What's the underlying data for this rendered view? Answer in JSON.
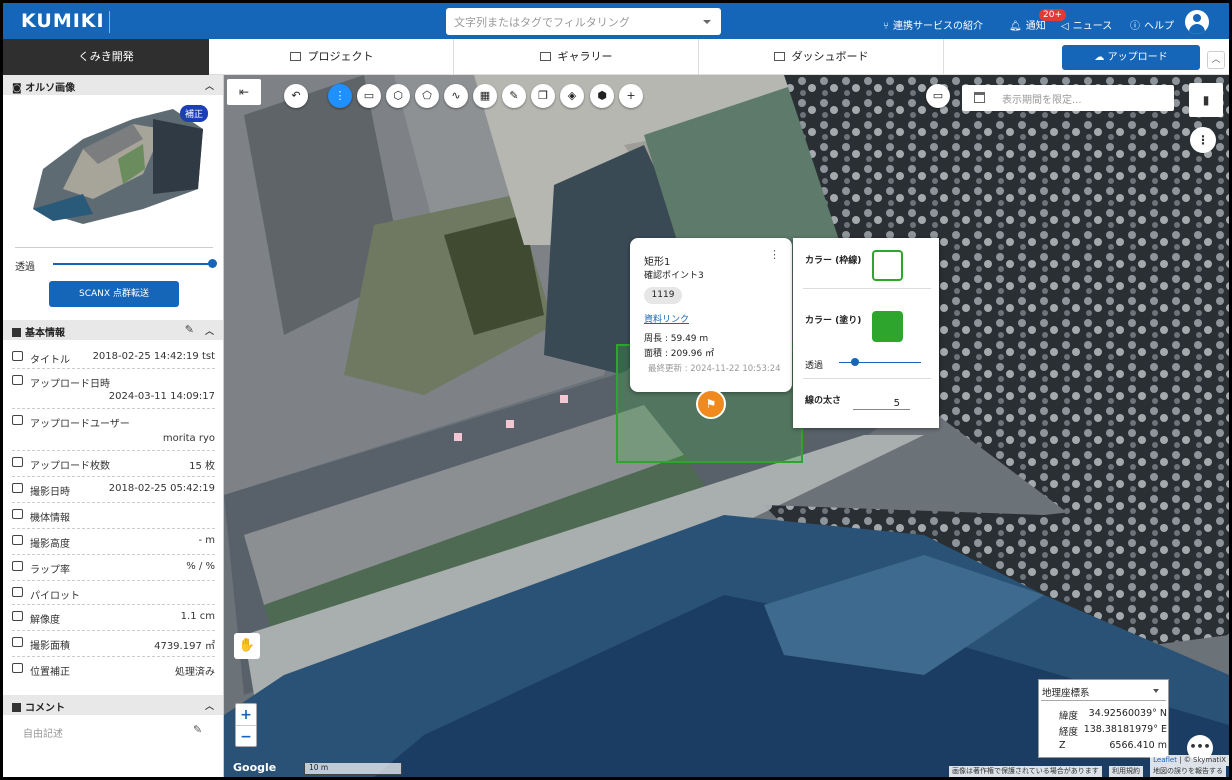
{
  "header": {
    "logo": "KUMIKI",
    "search_placeholder": "文字列またはタグでフィルタリング",
    "nav": {
      "integration": "連携サービスの紹介",
      "notifications": "通知",
      "notifications_badge": "20+",
      "news": "ニュース",
      "help": "ヘルプ"
    }
  },
  "tabs": {
    "org": "くみき開発",
    "project": "プロジェクト",
    "gallery": "ギャラリー",
    "dashboard": "ダッシュボード",
    "upload": "アップロード"
  },
  "sidebar": {
    "ortho_title": "オルソ画像",
    "ortho_badge": "補正",
    "transparency_label": "透過",
    "transparency_value": 1.0,
    "scanx_button": "SCANX 点群転送",
    "basic_info_title": "基本情報",
    "info": [
      {
        "label": "タイトル",
        "value": "2018-02-25 14:42:19 tst"
      },
      {
        "label": "アップロード日時",
        "value": "2024-03-11 14:09:17"
      },
      {
        "label": "アップロードユーザー",
        "value": "morita ryo"
      },
      {
        "label": "アップロード枚数",
        "value": "15 枚"
      },
      {
        "label": "撮影日時",
        "value": "2018-02-25 05:42:19"
      },
      {
        "label": "機体情報",
        "value": ""
      },
      {
        "label": "撮影高度",
        "value": "- m"
      },
      {
        "label": "ラップ率",
        "value": "% / %"
      },
      {
        "label": "パイロット",
        "value": ""
      },
      {
        "label": "解像度",
        "value": "1.1 cm"
      },
      {
        "label": "撮影面積",
        "value": "4739.197 ㎡"
      },
      {
        "label": "位置補正",
        "value": "処理済み"
      }
    ],
    "comment_title": "コメント",
    "comment_placeholder": "自由記述"
  },
  "map": {
    "period_placeholder": "表示期間を限定...",
    "popup": {
      "title": "矩形1",
      "subtitle": "確認ポイント3",
      "tag": "1119",
      "link": "資料リンク",
      "perimeter": "周長 : 59.49 m",
      "area": "面積 : 209.96 ㎡",
      "updated": "最終更新 : 2024-11-22 10:53:24"
    },
    "style_panel": {
      "stroke_color_label": "カラー (枠線)",
      "fill_color_label": "カラー (塗り)",
      "transparency_label": "透過",
      "transparency_value": 0.2,
      "line_width_label": "線の太さ",
      "line_width_value": "5",
      "color": "#2ea62e"
    },
    "coords": {
      "system": "地理座標系",
      "lat_label": "緯度",
      "lat": "34.92560039° N",
      "lon_label": "経度",
      "lon": "138.38181979° E",
      "z_label": "Z",
      "z": "6566.410 m"
    },
    "scale": "10 m",
    "google": "Google",
    "attribution_leaflet": "Leaflet",
    "attribution_rest": " | © SkymatiX",
    "attribution_copyright": "画像は著作権で保護されている場合があります",
    "attribution_terms": "利用規約",
    "attribution_report": "地図の誤りを報告する"
  },
  "colors": {
    "brand": "#1566b8",
    "dark": "#2f2f2f",
    "accent_green": "#2ea62e",
    "badge_red": "#e53935"
  }
}
